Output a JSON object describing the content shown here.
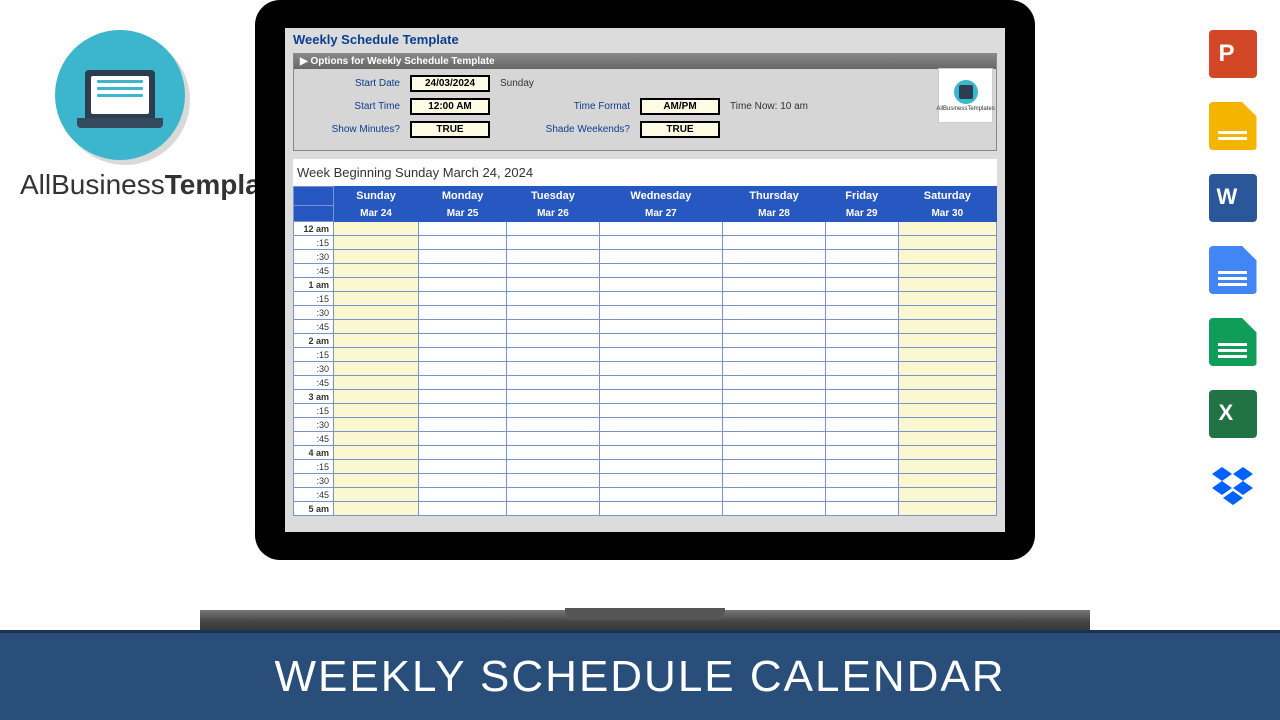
{
  "brand": {
    "line1": "AllBusiness",
    "line2": "Templates"
  },
  "doc": {
    "title": "Weekly Schedule Template",
    "options_header": "▶ Options for Weekly Schedule Template",
    "start_date_label": "Start Date",
    "start_date_value": "24/03/2024",
    "start_date_day": "Sunday",
    "start_time_label": "Start Time",
    "start_time_value": "12:00 AM",
    "time_format_label": "Time Format",
    "time_format_value": "AM/PM",
    "time_format_hint": "Time Now: 10 am",
    "show_minutes_label": "Show Minutes?",
    "show_minutes_value": "TRUE",
    "shade_weekends_label": "Shade Weekends?",
    "shade_weekends_value": "TRUE"
  },
  "badge_text": "AllBusinessTemplates",
  "calendar": {
    "week_title": "Week Beginning Sunday March 24, 2024",
    "days": [
      "Sunday",
      "Monday",
      "Tuesday",
      "Wednesday",
      "Thursday",
      "Friday",
      "Saturday"
    ],
    "dates": [
      "Mar 24",
      "Mar 25",
      "Mar 26",
      "Mar 27",
      "Mar 28",
      "Mar 29",
      "Mar 30"
    ],
    "time_rows": [
      "12 am",
      ":15",
      ":30",
      ":45",
      "1 am",
      ":15",
      ":30",
      ":45",
      "2 am",
      ":15",
      ":30",
      ":45",
      "3 am",
      ":15",
      ":30",
      ":45",
      "4 am",
      ":15",
      ":30",
      ":45",
      "5 am"
    ]
  },
  "banner": "WEEKLY SCHEDULE CALENDAR",
  "icons": [
    "powerpoint",
    "google-slides",
    "word",
    "google-docs",
    "google-sheets",
    "excel",
    "dropbox"
  ]
}
